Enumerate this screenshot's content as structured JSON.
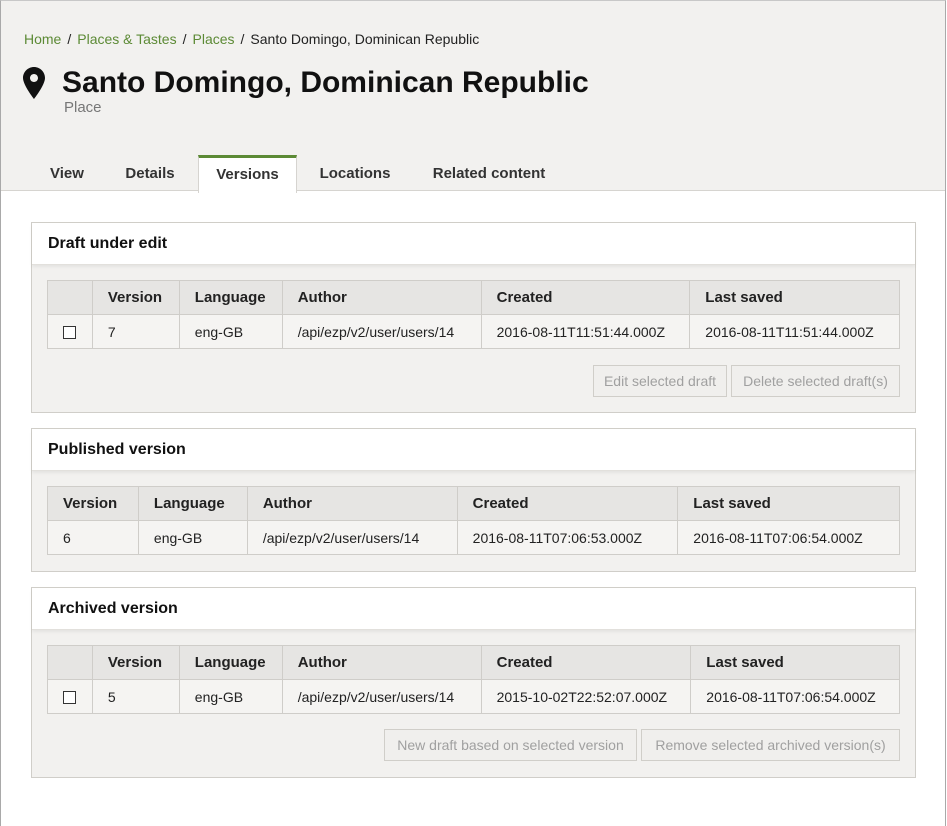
{
  "breadcrumb": {
    "items": [
      "Home",
      "Places & Tastes",
      "Places"
    ],
    "separator": "/",
    "current": "Santo Domingo, Dominican Republic"
  },
  "header": {
    "icon": "map-pin-icon",
    "title": "Santo Domingo, Dominican Republic",
    "subtitle": "Place"
  },
  "tabs": [
    {
      "label": "View",
      "active": false
    },
    {
      "label": "Details",
      "active": false
    },
    {
      "label": "Versions",
      "active": true
    },
    {
      "label": "Locations",
      "active": false
    },
    {
      "label": "Related content",
      "active": false
    }
  ],
  "draft": {
    "title": "Draft under edit",
    "columns": [
      "Version",
      "Language",
      "Author",
      "Created",
      "Last saved"
    ],
    "rows": [
      {
        "version": "7",
        "language": "eng-GB",
        "author": "/api/ezp/v2/user/users/14",
        "created": "2016-08-11T11:51:44.000Z",
        "last_saved": "2016-08-11T11:51:44.000Z"
      }
    ],
    "buttons": {
      "edit": "Edit selected draft",
      "delete": "Delete selected draft(s)"
    }
  },
  "published": {
    "title": "Published version",
    "columns": [
      "Version",
      "Language",
      "Author",
      "Created",
      "Last saved"
    ],
    "rows": [
      {
        "version": "6",
        "language": "eng-GB",
        "author": "/api/ezp/v2/user/users/14",
        "created": "2016-08-11T07:06:53.000Z",
        "last_saved": "2016-08-11T07:06:54.000Z"
      }
    ]
  },
  "archived": {
    "title": "Archived version",
    "columns": [
      "Version",
      "Language",
      "Author",
      "Created",
      "Last saved"
    ],
    "rows": [
      {
        "version": "5",
        "language": "eng-GB",
        "author": "/api/ezp/v2/user/users/14",
        "created": "2015-10-02T22:52:07.000Z",
        "last_saved": "2016-08-11T07:06:54.000Z"
      }
    ],
    "buttons": {
      "new_draft": "New draft based on selected version",
      "remove": "Remove selected archived version(s)"
    }
  },
  "colors": {
    "accent": "#5c8a35",
    "header_bg": "#f2f1ef",
    "disabled_text": "#a0a0a0"
  }
}
